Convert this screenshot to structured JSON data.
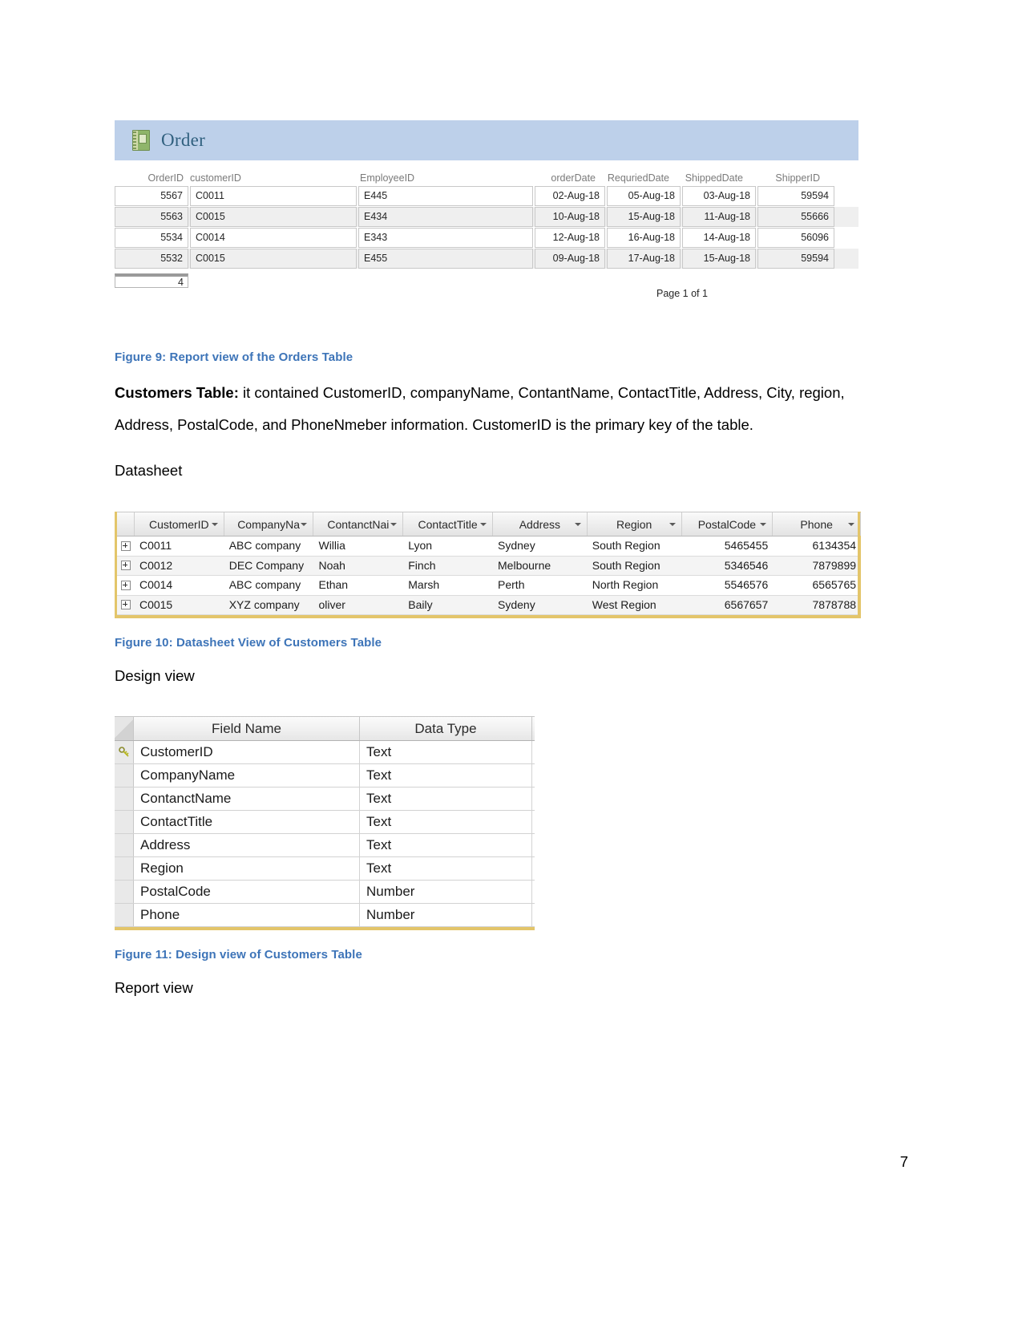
{
  "order_report": {
    "title": "Order",
    "icon": "table-report-icon",
    "columns": [
      "OrderID",
      "customerID",
      "EmployeeID",
      "orderDate",
      "RequriedDate",
      "ShippedDate",
      "ShipperID"
    ],
    "rows": [
      {
        "order_id": "5567",
        "customer_id": "C0011",
        "employee_id": "E445",
        "order_date": "02-Aug-18",
        "required_date": "05-Aug-18",
        "shipped_date": "03-Aug-18",
        "shipper_id": "59594"
      },
      {
        "order_id": "5563",
        "customer_id": "C0015",
        "employee_id": "E434",
        "order_date": "10-Aug-18",
        "required_date": "15-Aug-18",
        "shipped_date": "11-Aug-18",
        "shipper_id": "55666"
      },
      {
        "order_id": "5534",
        "customer_id": "C0014",
        "employee_id": "E343",
        "order_date": "12-Aug-18",
        "required_date": "16-Aug-18",
        "shipped_date": "14-Aug-18",
        "shipper_id": "56096"
      },
      {
        "order_id": "5532",
        "customer_id": "C0015",
        "employee_id": "E455",
        "order_date": "09-Aug-18",
        "required_date": "17-Aug-18",
        "shipped_date": "15-Aug-18",
        "shipper_id": "59594"
      }
    ],
    "record_count": "4",
    "page_indicator": "Page 1 of 1"
  },
  "captions": {
    "figure9": "Figure 9: Report view of the Orders Table",
    "figure10": "Figure 10: Datasheet View of Customers Table",
    "figure11": "Figure 11: Design view of Customers Table"
  },
  "body": {
    "customers_table_label": "Customers Table:",
    "customers_table_text": " it contained CustomerID, companyName, ContantName, ContactTitle, Address, City, region, Address, PostalCode, and PhoneNmeber information. CustomerID is the primary key of the table.",
    "datasheet_label": "Datasheet",
    "design_view_label": "Design view",
    "report_view_label": "Report view"
  },
  "datasheet": {
    "columns": [
      {
        "label": "CustomerID",
        "sort_icon": "chevron-down-icon"
      },
      {
        "label": "CompanyNa",
        "sort_icon": "chevron-down-icon"
      },
      {
        "label": "ContanctNai",
        "sort_icon": "chevron-down-icon"
      },
      {
        "label": "ContactTitle",
        "sort_icon": "chevron-down-icon"
      },
      {
        "label": "Address",
        "sort_icon": "chevron-down-icon"
      },
      {
        "label": "Region",
        "sort_icon": "chevron-down-icon"
      },
      {
        "label": "PostalCode",
        "sort_icon": "chevron-down-icon"
      },
      {
        "label": "Phone",
        "sort_icon": "chevron-down-icon"
      }
    ],
    "rows": [
      {
        "customer_id": "C0011",
        "company_name": "ABC company",
        "contact_name": "Willia",
        "contact_title": "Lyon",
        "address": "Sydney",
        "region": "South Region",
        "postal_code": "5465455",
        "phone": "6134354"
      },
      {
        "customer_id": "C0012",
        "company_name": "DEC Company",
        "contact_name": "Noah",
        "contact_title": "Finch",
        "address": "Melbourne",
        "region": "South Region",
        "postal_code": "5346546",
        "phone": "7879899"
      },
      {
        "customer_id": "C0014",
        "company_name": "ABC company",
        "contact_name": "Ethan",
        "contact_title": "Marsh",
        "address": "Perth",
        "region": "North Region",
        "postal_code": "5546576",
        "phone": "6565765"
      },
      {
        "customer_id": "C0015",
        "company_name": "XYZ company",
        "contact_name": "oliver",
        "contact_title": "Baily",
        "address": "Sydeny",
        "region": "West Region",
        "postal_code": "6567657",
        "phone": "7878788"
      }
    ]
  },
  "design_view": {
    "headers": {
      "field_name": "Field Name",
      "data_type": "Data Type"
    },
    "rows": [
      {
        "field_name": "CustomerID",
        "data_type": "Text",
        "primary_key": true
      },
      {
        "field_name": "CompanyName",
        "data_type": "Text",
        "primary_key": false
      },
      {
        "field_name": "ContanctName",
        "data_type": "Text",
        "primary_key": false
      },
      {
        "field_name": "ContactTitle",
        "data_type": "Text",
        "primary_key": false
      },
      {
        "field_name": "Address",
        "data_type": "Text",
        "primary_key": false
      },
      {
        "field_name": "Region",
        "data_type": "Text",
        "primary_key": false
      },
      {
        "field_name": "PostalCode",
        "data_type": "Number",
        "primary_key": false
      },
      {
        "field_name": "Phone",
        "data_type": "Number",
        "primary_key": false
      }
    ]
  },
  "footer": {
    "page_number": "7"
  },
  "colors": {
    "caption_blue": "#3d74b8",
    "report_header_blue": "#bdd0ea",
    "report_title_text": "#30607f",
    "access_gold": "#e3c56a"
  }
}
